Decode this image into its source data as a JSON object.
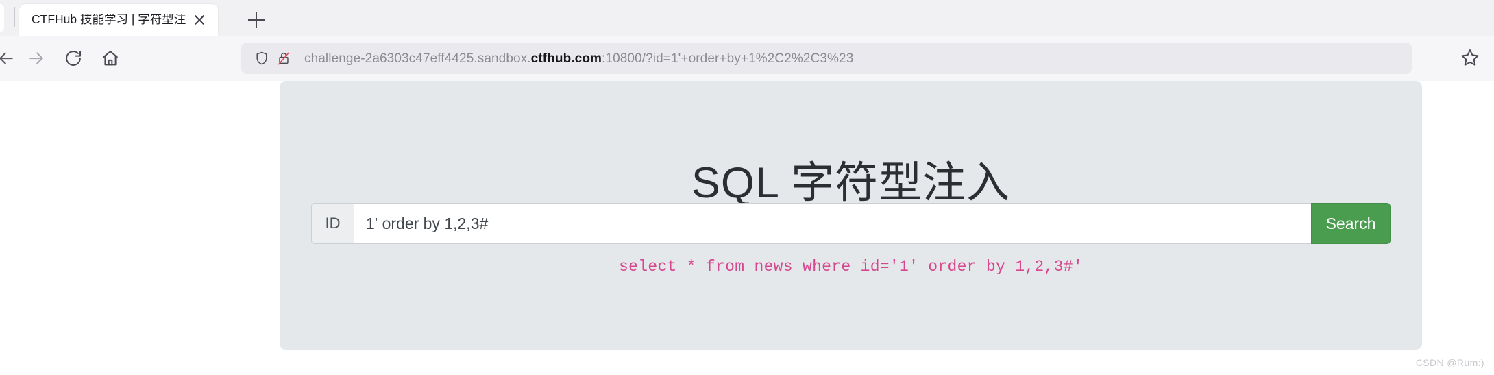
{
  "browser": {
    "tab": {
      "title": "CTFHub 技能学习 | 字符型注入",
      "close_label": "×",
      "new_tab_label": "+"
    },
    "nav": {
      "back_icon": "arrow-left-icon",
      "forward_icon": "arrow-right-icon",
      "reload_icon": "reload-icon",
      "home_icon": "home-icon"
    },
    "url_bar": {
      "shield_icon": "shield-icon",
      "insecure_icon": "lock-crossed-out-icon",
      "prefix": "challenge-2a6303c47eff4425.sandbox.",
      "host_highlight": "ctfhub.com",
      "suffix": ":10800/?id=1'+order+by+1%2C2%2C3%23",
      "full_url": "challenge-2a6303c47eff4425.sandbox.ctfhub.com:10800/?id=1'+order+by+1%2C2%2C3%23",
      "bookmark_icon": "star-icon"
    }
  },
  "page": {
    "title": "SQL 字符型注入",
    "form": {
      "addon_label": "ID",
      "input_value": "1' order by 1,2,3#",
      "input_placeholder": "",
      "submit_label": "Search"
    },
    "sql_output": "select * from news where id='1' order by 1,2,3#'",
    "watermark": "CSDN @Rum:)"
  },
  "colors": {
    "submit_green": "#4a9d4f",
    "sql_pink": "#d6478f",
    "panel_bg": "#e5e8ea",
    "chrome_bg": "#f6f6f8"
  }
}
